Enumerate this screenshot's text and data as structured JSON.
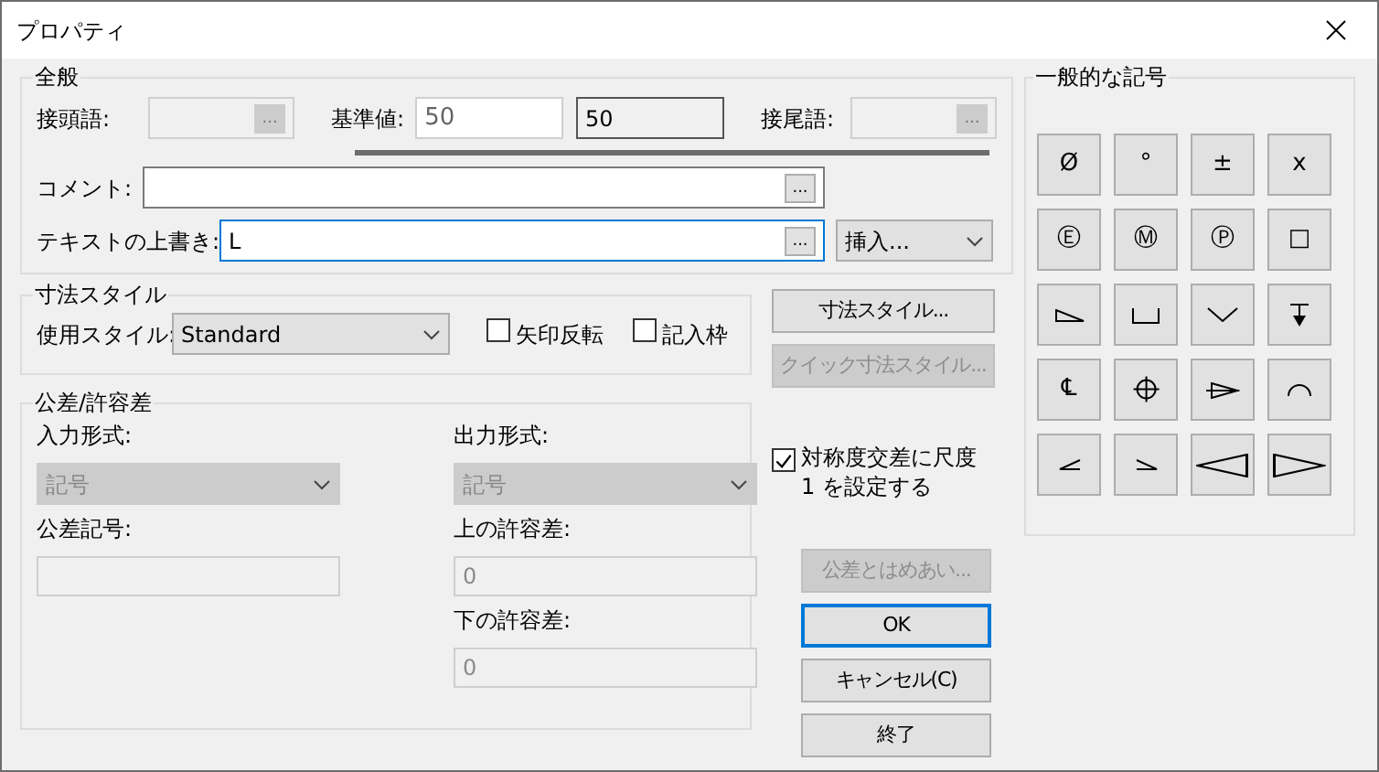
{
  "window": {
    "title": "プロパティ"
  },
  "general": {
    "title": "全般",
    "prefix": {
      "label": "接頭語:",
      "disabled": true,
      "button": "..."
    },
    "base_value": {
      "label": "基準値:",
      "value": "50",
      "computed": "50"
    },
    "suffix": {
      "label": "接尾語:",
      "disabled": true,
      "button": "..."
    },
    "comment": {
      "label": "コメント:",
      "focused": false,
      "button": "..."
    },
    "override": {
      "label": "テキストの上書き:",
      "value": "L",
      "focused": true,
      "button": "..."
    },
    "insert_dropdown": {
      "label": "挿入..."
    }
  },
  "dim_style": {
    "title": "寸法スタイル",
    "style_label": "使用スタイル:",
    "style_value": "Standard",
    "checkboxes": [
      {
        "label": "矢印反転",
        "checked": false
      },
      {
        "label": "記入枠",
        "checked": false
      }
    ]
  },
  "tolerance": {
    "title": "公差/許容差",
    "input_format": {
      "label": "入力形式:",
      "value": "記号",
      "disabled": true
    },
    "output_format": {
      "label": "出力形式:",
      "value": "記号",
      "disabled": true
    },
    "tolerance_symbol": {
      "label": "公差記号:",
      "disabled": true
    },
    "upper": {
      "label": "上の許容差:",
      "value": "0",
      "disabled": true
    },
    "lower": {
      "label": "下の許容差:",
      "value": "0",
      "disabled": true
    }
  },
  "side_buttons": [
    {
      "label": "寸法スタイル...",
      "disabled": false
    },
    {
      "label": "クイック寸法スタイル...",
      "disabled": true
    }
  ],
  "symmetric_checkbox": {
    "label": "対称度交差に尺度 1 を設定する",
    "checked": true
  },
  "action_buttons": [
    {
      "label": "公差とはめあい...",
      "disabled": true,
      "default": false
    },
    {
      "label": "OK",
      "disabled": false,
      "default": true
    },
    {
      "label": "キャンセル(C)",
      "disabled": false,
      "default": false
    },
    {
      "label": "終了",
      "disabled": false,
      "default": false
    }
  ],
  "symbols": {
    "title": "一般的な記号",
    "items": [
      {
        "kind": "glyph",
        "label": "Ø"
      },
      {
        "kind": "glyph",
        "label": "°"
      },
      {
        "kind": "glyph",
        "label": "±"
      },
      {
        "kind": "glyph",
        "label": "x"
      },
      {
        "kind": "glyph",
        "label": "Ⓔ"
      },
      {
        "kind": "glyph",
        "label": "Ⓜ"
      },
      {
        "kind": "glyph",
        "label": "Ⓟ"
      },
      {
        "kind": "glyph",
        "label": "□"
      },
      {
        "kind": "slope"
      },
      {
        "kind": "counterbore"
      },
      {
        "kind": "countersink"
      },
      {
        "kind": "depth"
      },
      {
        "kind": "glyph",
        "label": "℄"
      },
      {
        "kind": "position"
      },
      {
        "kind": "conical"
      },
      {
        "kind": "arc"
      },
      {
        "kind": "angle-left"
      },
      {
        "kind": "angle-right"
      },
      {
        "kind": "cone-left"
      },
      {
        "kind": "cone-right"
      }
    ]
  }
}
